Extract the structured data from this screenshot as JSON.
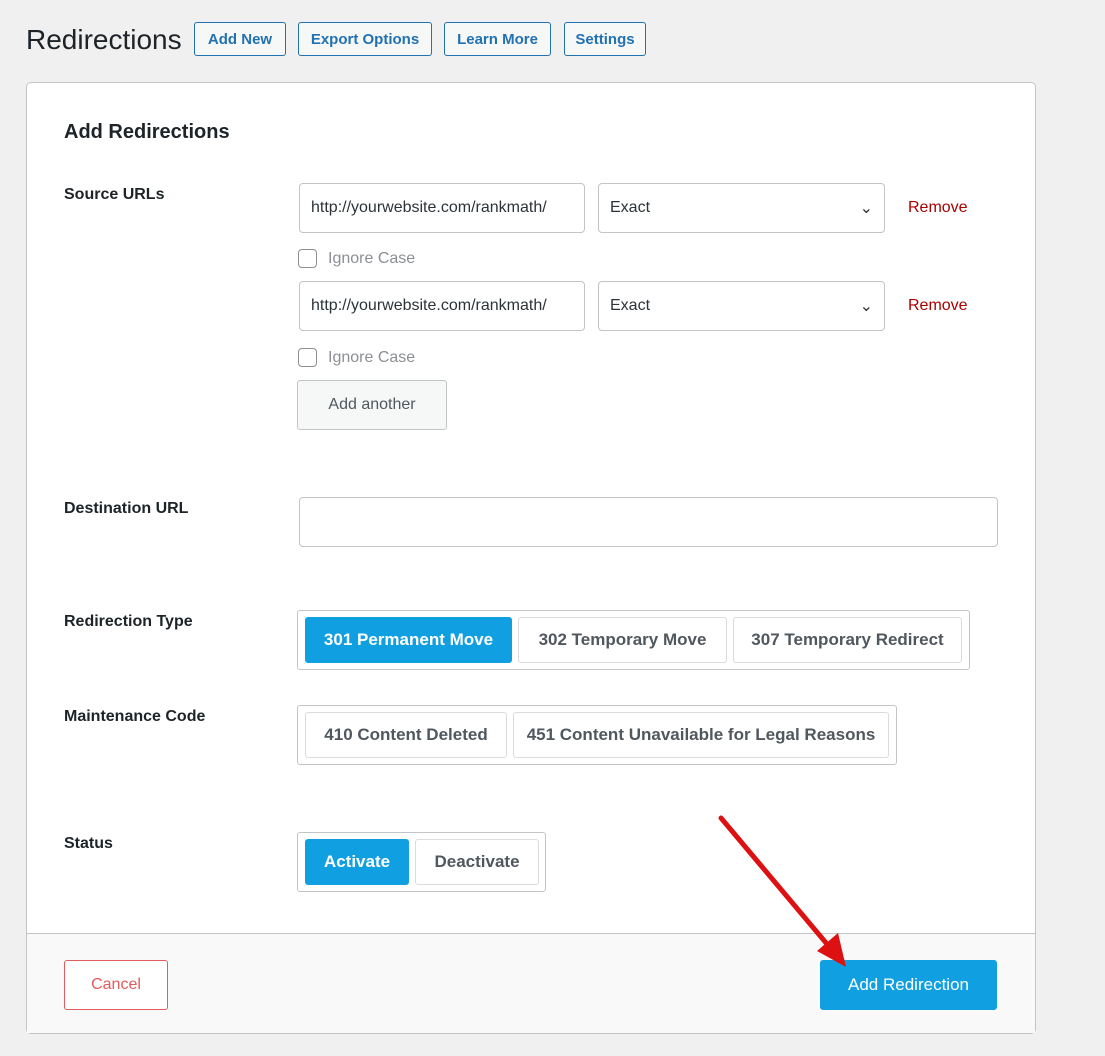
{
  "header": {
    "title": "Redirections",
    "buttons": [
      "Add New",
      "Export Options",
      "Learn More",
      "Settings"
    ]
  },
  "form": {
    "title": "Add Redirections",
    "source_label": "Source URLs",
    "sources": [
      {
        "url": "http://yourwebsite.com/rankmath/",
        "match": "Exact",
        "remove": "Remove",
        "ignore_case": "Ignore Case",
        "ignore_checked": false
      },
      {
        "url": "http://yourwebsite.com/rankmath/",
        "match": "Exact",
        "remove": "Remove",
        "ignore_case": "Ignore Case",
        "ignore_checked": false
      }
    ],
    "add_another": "Add another",
    "destination_label": "Destination URL",
    "destination_value": "",
    "type_label": "Redirection Type",
    "types": [
      {
        "label": "301 Permanent Move",
        "selected": true
      },
      {
        "label": "302 Temporary Move",
        "selected": false
      },
      {
        "label": "307 Temporary Redirect",
        "selected": false
      }
    ],
    "maintenance_label": "Maintenance Code",
    "maintenance": [
      {
        "label": "410 Content Deleted",
        "selected": false
      },
      {
        "label": "451 Content Unavailable for Legal Reasons",
        "selected": false
      }
    ],
    "status_label": "Status",
    "status": [
      {
        "label": "Activate",
        "selected": true
      },
      {
        "label": "Deactivate",
        "selected": false
      }
    ]
  },
  "footer": {
    "cancel": "Cancel",
    "submit": "Add Redirection"
  },
  "colors": {
    "accent": "#10a0e2",
    "link": "#2271b1",
    "remove": "#aa0000",
    "arrow": "#dd1111"
  },
  "annotation": {
    "icon": "red-arrow-icon"
  }
}
